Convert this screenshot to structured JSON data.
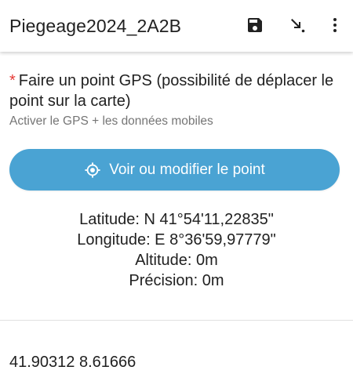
{
  "appbar": {
    "title": "Piegeage2024_2A2B",
    "save_icon": "save-icon",
    "goto_icon": "jump-to-arrow-icon",
    "menu_icon": "more-vertical-icon"
  },
  "question": {
    "required_marker": "*",
    "label": "Faire un point GPS (possibilité de déplacer le point sur la carte)",
    "hint": "Activer le GPS + les données mobiles"
  },
  "gps_button": {
    "label": "Voir ou modifier le point",
    "icon": "gps-target-icon"
  },
  "coordinates": {
    "latitude": "Latitude: N 41°54'11,22835\"",
    "longitude": "Longitude: E 8°36'59,97779\"",
    "altitude": "Altitude: 0m",
    "precision": "Précision: 0m"
  },
  "raw_value": "41.90312 8.61666",
  "colors": {
    "accent": "#4aa3d3",
    "required": "#e53935",
    "hint": "#757575",
    "text": "#212121"
  }
}
